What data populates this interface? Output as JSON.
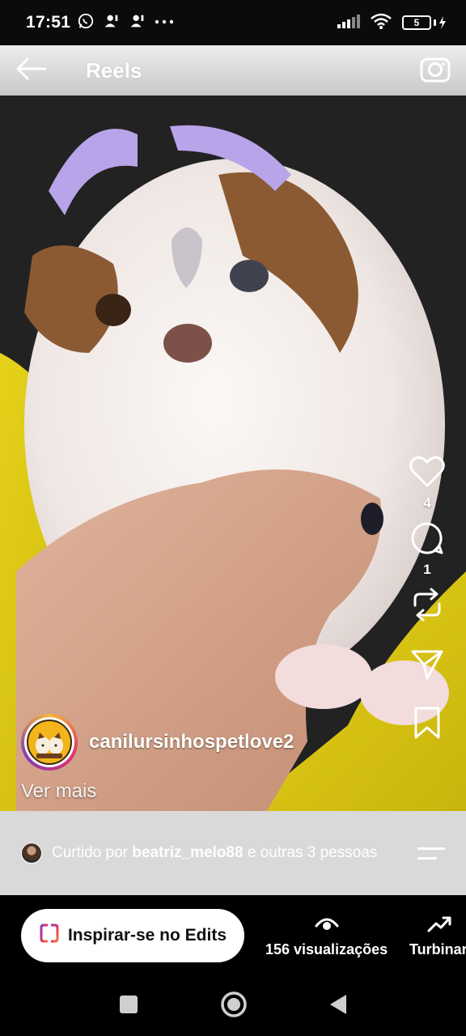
{
  "status_bar": {
    "time": "17:51",
    "left_icons": [
      "whatsapp-icon",
      "person-notification-icon",
      "person-notification-icon",
      "more-dots-icon"
    ],
    "right_icons": [
      "signal-icon",
      "wifi-icon",
      "battery-icon"
    ],
    "battery_level": "5"
  },
  "top_bar": {
    "title": "Reels",
    "back_icon": "arrow-left-icon",
    "camera_icon": "camera-icon"
  },
  "actions": {
    "like_count": "4",
    "comment_count": "1",
    "icons": [
      "heart-icon",
      "comment-icon",
      "repost-icon",
      "send-icon",
      "bookmark-icon"
    ]
  },
  "post": {
    "username": "canilursinhospetlove2",
    "ver_mais": "Ver mais"
  },
  "liked_by": {
    "prefix": "Curtido por",
    "user": "beatriz_melo88",
    "suffix": "e outras 3 pessoas"
  },
  "bottom": {
    "edits_label": "Inspirar-se no Edits",
    "views_label": "156 visualizações",
    "boost_label": "Turbinar"
  },
  "nav": [
    "recents-square-icon",
    "home-circle-icon",
    "back-triangle-icon"
  ],
  "colors": {
    "liked_bar_bg": "#d9d9d9",
    "bottom_bg": "#000000",
    "avatar_ring": "#e1306c"
  }
}
